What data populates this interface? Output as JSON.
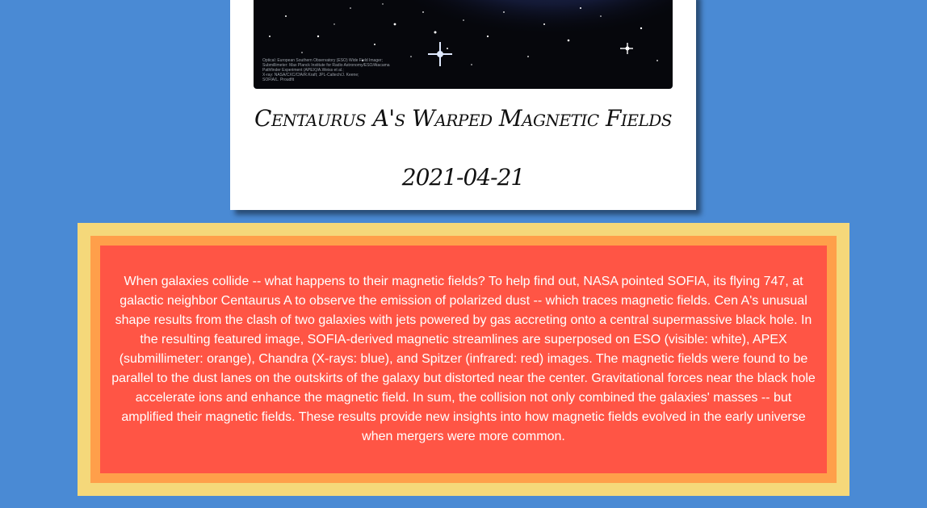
{
  "apod": {
    "image_credit": [
      "Optical: European Southern Observatory (ESO) Wide Field Imager;",
      "Submillimeter: Max Planck Institute for Radio Astronomy/ESO/Atacama",
      "Pathfinder Experiment (APEX)/A.Weiss et al.;",
      "X-ray: NASA/CXC/CfA/R.Kraft; JPL-Caltech/J. Keene;",
      "SOFIA/L. Proudfit"
    ],
    "title": "Centaurus A's Warped Magnetic Fields",
    "date": "2021-04-21",
    "explanation": "When galaxies collide -- what happens to their magnetic fields? To help find out, NASA pointed SOFIA, its flying 747, at galactic neighbor Centaurus A to observe the emission of polarized dust -- which traces magnetic fields. Cen A's unusual shape results from the clash of two galaxies with jets powered by gas accreting onto a central supermassive black hole. In the resulting featured image, SOFIA-derived magnetic streamlines are superposed on ESO (visible: white), APEX (submillimeter: orange), Chandra (X-rays: blue), and Spitzer (infrared: red) images. The magnetic fields were found to be parallel to the dust lanes on the outskirts of the galaxy but distorted near the center. Gravitational forces near the black hole accelerate ions and enhance the magnetic field. In sum, the collision not only combined the galaxies' masses -- but amplified their magnetic fields. These results provide new insights into how magnetic fields evolved in the early universe when mergers were more common."
  },
  "colors": {
    "background": "#4a8ad4",
    "card": "#ffffff",
    "frame_outer": "#f5d87a",
    "frame_mid": "#ff9f4a",
    "frame_inner": "#ff5545"
  }
}
